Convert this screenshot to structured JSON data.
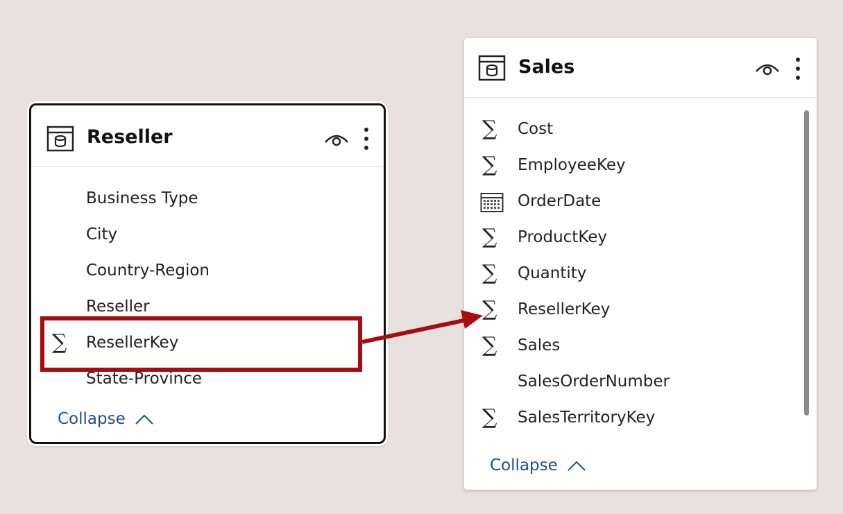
{
  "reseller_table": {
    "title": "Reseller",
    "fields": [
      {
        "label": "Business Type",
        "icon": ""
      },
      {
        "label": "City",
        "icon": ""
      },
      {
        "label": "Country-Region",
        "icon": ""
      },
      {
        "label": "Reseller",
        "icon": ""
      },
      {
        "label": "ResellerKey",
        "icon": "sigma-icon"
      },
      {
        "label": "State-Province",
        "icon": ""
      }
    ],
    "collapse_label": "Collapse"
  },
  "sales_table": {
    "title": "Sales",
    "fields": [
      {
        "label": "Cost",
        "icon": "sigma-icon"
      },
      {
        "label": "EmployeeKey",
        "icon": "sigma-icon"
      },
      {
        "label": "OrderDate",
        "icon": "calendar-icon"
      },
      {
        "label": "ProductKey",
        "icon": "sigma-icon"
      },
      {
        "label": "Quantity",
        "icon": "sigma-icon"
      },
      {
        "label": "ResellerKey",
        "icon": "sigma-icon"
      },
      {
        "label": "Sales",
        "icon": "sigma-icon"
      },
      {
        "label": "SalesOrderNumber",
        "icon": ""
      },
      {
        "label": "SalesTerritoryKey",
        "icon": "sigma-icon"
      }
    ],
    "collapse_label": "Collapse"
  },
  "sigma_glyph": "∑",
  "colors": {
    "highlight": "#a80c10",
    "link": "#1f4e8c",
    "background": "#e8e1df"
  }
}
